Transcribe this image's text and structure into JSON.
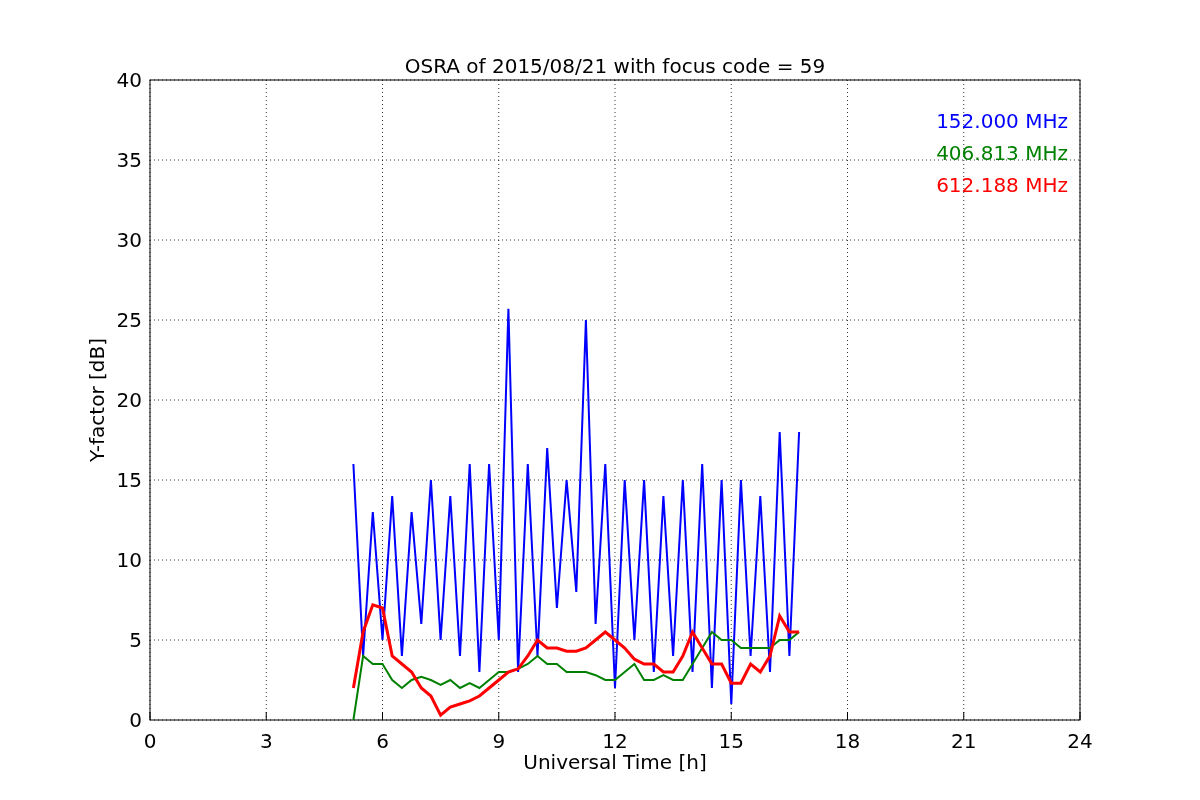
{
  "chart_data": {
    "type": "line",
    "title": "OSRA of 2015/08/21 with focus code = 59",
    "xlabel": "Universal Time [h]",
    "ylabel": "Y-factor [dB]",
    "xlim": [
      0,
      24
    ],
    "ylim": [
      0,
      40
    ],
    "xticks": [
      0,
      3,
      6,
      9,
      12,
      15,
      18,
      21,
      24
    ],
    "yticks": [
      0,
      5,
      10,
      15,
      20,
      25,
      30,
      35,
      40
    ],
    "grid": true,
    "x": [
      5.25,
      5.5,
      5.75,
      6,
      6.25,
      6.5,
      6.75,
      7,
      7.25,
      7.5,
      7.75,
      8,
      8.25,
      8.5,
      8.75,
      9,
      9.25,
      9.5,
      9.75,
      10,
      10.25,
      10.5,
      10.75,
      11,
      11.25,
      11.5,
      11.75,
      12,
      12.25,
      12.5,
      12.75,
      13,
      13.25,
      13.5,
      13.75,
      14,
      14.25,
      14.5,
      14.75,
      15,
      15.25,
      15.5,
      15.75,
      16,
      16.25,
      16.5,
      16.75
    ],
    "series": [
      {
        "name": "152.000 MHz",
        "color": "#0000ff",
        "values": [
          16,
          4,
          13,
          5,
          14,
          4,
          13,
          6,
          15,
          5,
          14,
          4,
          16,
          3,
          16,
          5,
          25.7,
          3,
          16,
          4,
          17,
          7,
          15,
          8,
          25,
          6,
          16,
          2,
          15,
          5,
          15,
          3,
          14,
          4,
          15,
          3,
          16,
          2,
          15,
          1,
          15,
          4,
          14,
          3,
          18,
          4,
          18
        ]
      },
      {
        "name": "406.813 MHz",
        "color": "#008000",
        "values": [
          0,
          4,
          3.5,
          3.5,
          2.5,
          2,
          2.5,
          2.7,
          2.5,
          2.2,
          2.5,
          2,
          2.3,
          2,
          2.5,
          3,
          3,
          3.2,
          3.5,
          4,
          3.5,
          3.5,
          3,
          3,
          3,
          2.8,
          2.5,
          2.5,
          3,
          3.5,
          2.5,
          2.5,
          2.8,
          2.5,
          2.5,
          3.5,
          4.5,
          5.5,
          5,
          5,
          4.5,
          4.5,
          4.5,
          4.5,
          5,
          5,
          5.5
        ]
      },
      {
        "name": "612.188 MHz",
        "color": "#ff0000",
        "values": [
          2,
          5.5,
          7.2,
          7,
          4,
          3.5,
          3,
          2,
          1.5,
          0.3,
          0.8,
          1,
          1.2,
          1.5,
          2,
          2.5,
          3,
          3.2,
          4,
          5,
          4.5,
          4.5,
          4.3,
          4.3,
          4.5,
          5,
          5.5,
          5,
          4.5,
          3.8,
          3.5,
          3.5,
          3,
          3,
          4,
          5.5,
          4.5,
          3.5,
          3.5,
          2.3,
          2.3,
          3.5,
          3,
          4,
          6.5,
          5.5,
          5.5
        ]
      }
    ]
  }
}
